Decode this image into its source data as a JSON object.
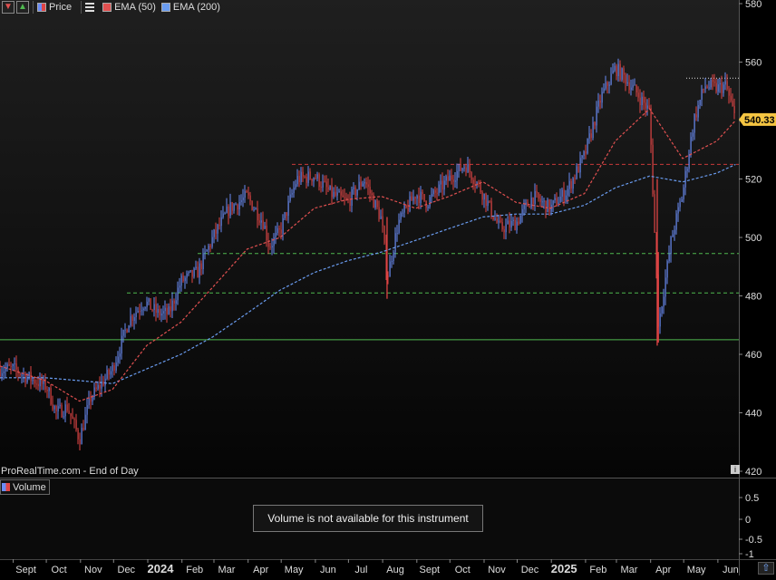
{
  "legend": {
    "items": [
      {
        "label": "Price",
        "color": "#e05050"
      },
      {
        "label": "EMA (50)",
        "color": "#e05050"
      },
      {
        "label": "EMA (200)",
        "color": "#6a9cf0"
      }
    ]
  },
  "source": "ProRealTime.com - End of Day",
  "volume_panel": {
    "title": "Volume",
    "message": "Volume is not available for this instrument",
    "y_ticks": [
      "0.5",
      "0",
      "-0.5",
      "-1"
    ]
  },
  "chart_data": {
    "type": "candlestick",
    "title": "",
    "y_ticks": [
      420,
      440,
      460,
      480,
      500,
      520,
      540,
      560,
      580
    ],
    "ylim": [
      419,
      583
    ],
    "x_ticks": [
      "Sept",
      "Oct",
      "Nov",
      "Dec",
      "2024",
      "Feb",
      "Mar",
      "Apr",
      "May",
      "Jun",
      "Jul",
      "Aug",
      "Sept",
      "Oct",
      "Nov",
      "Dec",
      "2025",
      "Feb",
      "Mar",
      "Apr",
      "May",
      "Jun"
    ],
    "last_price": "540.33",
    "horizontal_levels": [
      {
        "value": 465,
        "style": "solid",
        "color": "#4fb84f"
      },
      {
        "value": 481,
        "style": "dashed",
        "color": "#4fb84f"
      },
      {
        "value": 494.5,
        "style": "dashed",
        "color": "#4fb84f"
      },
      {
        "value": 525,
        "style": "dashed",
        "color": "#c83a3a"
      },
      {
        "value": 554.5,
        "style": "dotted",
        "color": "#dddddd"
      }
    ],
    "price_path": [
      [
        "2023-08-20",
        455
      ],
      [
        "2023-09-01",
        455
      ],
      [
        "2023-09-15",
        452
      ],
      [
        "2023-10-01",
        449
      ],
      [
        "2023-10-10",
        440
      ],
      [
        "2023-10-20",
        442
      ],
      [
        "2023-10-31",
        431
      ],
      [
        "2023-11-10",
        445
      ],
      [
        "2023-11-30",
        455
      ],
      [
        "2023-12-15",
        472
      ],
      [
        "2023-12-29",
        478
      ],
      [
        "2024-01-10",
        474
      ],
      [
        "2024-01-20",
        474
      ],
      [
        "2024-01-31",
        485
      ],
      [
        "2024-02-15",
        488
      ],
      [
        "2024-02-29",
        500
      ],
      [
        "2024-03-15",
        510
      ],
      [
        "2024-03-31",
        514
      ],
      [
        "2024-04-15",
        505
      ],
      [
        "2024-04-20",
        497
      ],
      [
        "2024-04-30",
        502
      ],
      [
        "2024-05-15",
        520
      ],
      [
        "2024-05-31",
        521
      ],
      [
        "2024-06-15",
        515
      ],
      [
        "2024-06-30",
        512
      ],
      [
        "2024-07-15",
        520
      ],
      [
        "2024-07-31",
        506
      ],
      [
        "2024-08-05",
        486
      ],
      [
        "2024-08-15",
        505
      ],
      [
        "2024-08-31",
        515
      ],
      [
        "2024-09-10",
        512
      ],
      [
        "2024-09-30",
        520
      ],
      [
        "2024-10-15",
        525
      ],
      [
        "2024-10-31",
        515
      ],
      [
        "2024-11-15",
        503
      ],
      [
        "2024-11-30",
        505
      ],
      [
        "2024-12-15",
        514
      ],
      [
        "2024-12-31",
        510
      ],
      [
        "2025-01-15",
        516
      ],
      [
        "2025-01-31",
        528
      ],
      [
        "2025-02-15",
        548
      ],
      [
        "2025-02-28",
        558
      ],
      [
        "2025-03-10",
        554
      ],
      [
        "2025-03-20",
        549
      ],
      [
        "2025-03-31",
        543
      ],
      [
        "2025-04-08",
        470
      ],
      [
        "2025-04-20",
        500
      ],
      [
        "2025-04-30",
        515
      ],
      [
        "2025-05-10",
        540
      ],
      [
        "2025-05-20",
        552
      ],
      [
        "2025-05-31",
        551
      ],
      [
        "2025-06-08",
        552
      ],
      [
        "2025-06-17",
        540
      ]
    ],
    "ema50": [
      [
        "2023-08-20",
        456
      ],
      [
        "2023-09-30",
        451
      ],
      [
        "2023-10-31",
        444
      ],
      [
        "2023-11-30",
        448
      ],
      [
        "2023-12-31",
        463
      ],
      [
        "2024-01-31",
        471
      ],
      [
        "2024-02-29",
        483
      ],
      [
        "2024-03-31",
        496
      ],
      [
        "2024-04-30",
        500
      ],
      [
        "2024-05-31",
        510
      ],
      [
        "2024-06-30",
        513
      ],
      [
        "2024-07-31",
        514
      ],
      [
        "2024-08-31",
        510
      ],
      [
        "2024-09-30",
        514
      ],
      [
        "2024-10-31",
        519
      ],
      [
        "2024-11-30",
        512
      ],
      [
        "2024-12-31",
        510
      ],
      [
        "2025-01-31",
        515
      ],
      [
        "2025-02-28",
        533
      ],
      [
        "2025-03-31",
        544
      ],
      [
        "2025-04-30",
        527
      ],
      [
        "2025-05-31",
        533
      ],
      [
        "2025-06-17",
        540
      ]
    ],
    "ema200": [
      [
        "2023-08-20",
        452
      ],
      [
        "2023-09-30",
        452
      ],
      [
        "2023-10-31",
        451
      ],
      [
        "2023-11-30",
        450
      ],
      [
        "2023-12-31",
        455
      ],
      [
        "2024-01-31",
        460
      ],
      [
        "2024-02-29",
        466
      ],
      [
        "2024-03-31",
        474
      ],
      [
        "2024-04-30",
        482
      ],
      [
        "2024-05-31",
        488
      ],
      [
        "2024-06-30",
        492
      ],
      [
        "2024-07-31",
        495
      ],
      [
        "2024-08-31",
        499
      ],
      [
        "2024-09-30",
        503
      ],
      [
        "2024-10-31",
        507
      ],
      [
        "2024-11-30",
        508
      ],
      [
        "2024-12-31",
        508
      ],
      [
        "2025-01-31",
        511
      ],
      [
        "2025-02-28",
        517
      ],
      [
        "2025-03-31",
        521
      ],
      [
        "2025-04-30",
        519
      ],
      [
        "2025-05-31",
        522
      ],
      [
        "2025-06-17",
        525
      ]
    ],
    "colors": {
      "up": "#6a8cf5",
      "down": "#e04545",
      "ema50": "#e05050",
      "ema200": "#6a9cf0",
      "last_price_bg": "#f5c542"
    }
  }
}
